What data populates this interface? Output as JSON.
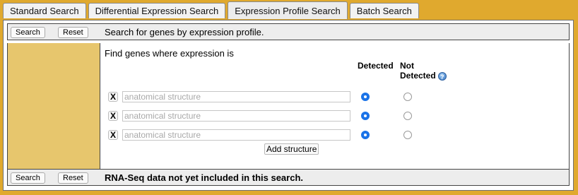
{
  "tabs": [
    {
      "label": "Standard Search",
      "active": false
    },
    {
      "label": "Differential Expression Search",
      "active": false
    },
    {
      "label": "Expression Profile Search",
      "active": true
    },
    {
      "label": "Batch Search",
      "active": false
    }
  ],
  "top_bar": {
    "search_label": "Search",
    "reset_label": "Reset",
    "message": "Search for genes by expression profile."
  },
  "form": {
    "intro": "Find genes where expression is",
    "detected_header": "Detected",
    "not_detected_header_line1": "Not",
    "not_detected_header_line2": "Detected",
    "help_icon": "help-icon",
    "rows": [
      {
        "remove_label": "X",
        "placeholder": "anatomical structure",
        "value": "",
        "selected": "detected"
      },
      {
        "remove_label": "X",
        "placeholder": "anatomical structure",
        "value": "",
        "selected": "detected"
      },
      {
        "remove_label": "X",
        "placeholder": "anatomical structure",
        "value": "",
        "selected": "detected"
      }
    ],
    "add_label": "Add structure"
  },
  "bottom_bar": {
    "search_label": "Search",
    "reset_label": "Reset",
    "message": "RNA-Seq data not yet included in this search."
  },
  "colors": {
    "background": "#e0a92e",
    "left_column": "#e7c66d",
    "radio_selected": "#1a73e8"
  }
}
